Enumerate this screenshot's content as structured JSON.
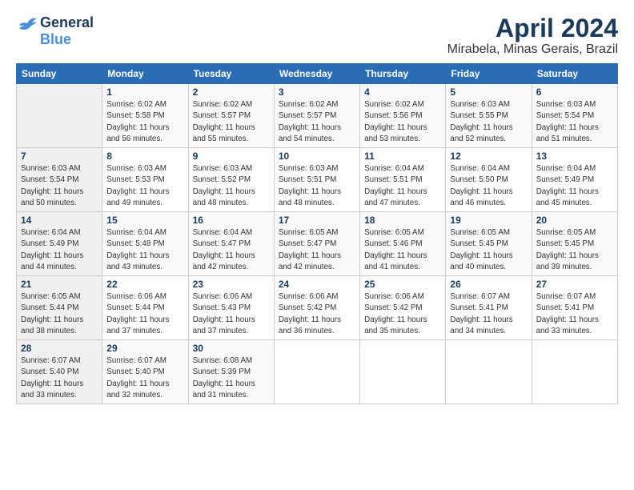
{
  "logo": {
    "line1": "General",
    "line2": "Blue"
  },
  "title": "April 2024",
  "subtitle": "Mirabela, Minas Gerais, Brazil",
  "days_of_week": [
    "Sunday",
    "Monday",
    "Tuesday",
    "Wednesday",
    "Thursday",
    "Friday",
    "Saturday"
  ],
  "weeks": [
    [
      {
        "day": "",
        "info": ""
      },
      {
        "day": "1",
        "info": "Sunrise: 6:02 AM\nSunset: 5:58 PM\nDaylight: 11 hours\nand 56 minutes."
      },
      {
        "day": "2",
        "info": "Sunrise: 6:02 AM\nSunset: 5:57 PM\nDaylight: 11 hours\nand 55 minutes."
      },
      {
        "day": "3",
        "info": "Sunrise: 6:02 AM\nSunset: 5:57 PM\nDaylight: 11 hours\nand 54 minutes."
      },
      {
        "day": "4",
        "info": "Sunrise: 6:02 AM\nSunset: 5:56 PM\nDaylight: 11 hours\nand 53 minutes."
      },
      {
        "day": "5",
        "info": "Sunrise: 6:03 AM\nSunset: 5:55 PM\nDaylight: 11 hours\nand 52 minutes."
      },
      {
        "day": "6",
        "info": "Sunrise: 6:03 AM\nSunset: 5:54 PM\nDaylight: 11 hours\nand 51 minutes."
      }
    ],
    [
      {
        "day": "7",
        "info": ""
      },
      {
        "day": "8",
        "info": "Sunrise: 6:03 AM\nSunset: 5:53 PM\nDaylight: 11 hours\nand 49 minutes."
      },
      {
        "day": "9",
        "info": "Sunrise: 6:03 AM\nSunset: 5:52 PM\nDaylight: 11 hours\nand 48 minutes."
      },
      {
        "day": "10",
        "info": "Sunrise: 6:03 AM\nSunset: 5:51 PM\nDaylight: 11 hours\nand 48 minutes."
      },
      {
        "day": "11",
        "info": "Sunrise: 6:04 AM\nSunset: 5:51 PM\nDaylight: 11 hours\nand 47 minutes."
      },
      {
        "day": "12",
        "info": "Sunrise: 6:04 AM\nSunset: 5:50 PM\nDaylight: 11 hours\nand 46 minutes."
      },
      {
        "day": "13",
        "info": "Sunrise: 6:04 AM\nSunset: 5:49 PM\nDaylight: 11 hours\nand 45 minutes."
      }
    ],
    [
      {
        "day": "14",
        "info": ""
      },
      {
        "day": "15",
        "info": "Sunrise: 6:04 AM\nSunset: 5:48 PM\nDaylight: 11 hours\nand 43 minutes."
      },
      {
        "day": "16",
        "info": "Sunrise: 6:04 AM\nSunset: 5:47 PM\nDaylight: 11 hours\nand 42 minutes."
      },
      {
        "day": "17",
        "info": "Sunrise: 6:05 AM\nSunset: 5:47 PM\nDaylight: 11 hours\nand 42 minutes."
      },
      {
        "day": "18",
        "info": "Sunrise: 6:05 AM\nSunset: 5:46 PM\nDaylight: 11 hours\nand 41 minutes."
      },
      {
        "day": "19",
        "info": "Sunrise: 6:05 AM\nSunset: 5:45 PM\nDaylight: 11 hours\nand 40 minutes."
      },
      {
        "day": "20",
        "info": "Sunrise: 6:05 AM\nSunset: 5:45 PM\nDaylight: 11 hours\nand 39 minutes."
      }
    ],
    [
      {
        "day": "21",
        "info": ""
      },
      {
        "day": "22",
        "info": "Sunrise: 6:06 AM\nSunset: 5:44 PM\nDaylight: 11 hours\nand 37 minutes."
      },
      {
        "day": "23",
        "info": "Sunrise: 6:06 AM\nSunset: 5:43 PM\nDaylight: 11 hours\nand 37 minutes."
      },
      {
        "day": "24",
        "info": "Sunrise: 6:06 AM\nSunset: 5:42 PM\nDaylight: 11 hours\nand 36 minutes."
      },
      {
        "day": "25",
        "info": "Sunrise: 6:06 AM\nSunset: 5:42 PM\nDaylight: 11 hours\nand 35 minutes."
      },
      {
        "day": "26",
        "info": "Sunrise: 6:07 AM\nSunset: 5:41 PM\nDaylight: 11 hours\nand 34 minutes."
      },
      {
        "day": "27",
        "info": "Sunrise: 6:07 AM\nSunset: 5:41 PM\nDaylight: 11 hours\nand 33 minutes."
      }
    ],
    [
      {
        "day": "28",
        "info": "Sunrise: 6:07 AM\nSunset: 5:40 PM\nDaylight: 11 hours\nand 33 minutes."
      },
      {
        "day": "29",
        "info": "Sunrise: 6:07 AM\nSunset: 5:40 PM\nDaylight: 11 hours\nand 32 minutes."
      },
      {
        "day": "30",
        "info": "Sunrise: 6:08 AM\nSunset: 5:39 PM\nDaylight: 11 hours\nand 31 minutes."
      },
      {
        "day": "",
        "info": ""
      },
      {
        "day": "",
        "info": ""
      },
      {
        "day": "",
        "info": ""
      },
      {
        "day": "",
        "info": ""
      }
    ]
  ],
  "week1_sunday_info": "Sunrise: 6:03 AM\nSunset: 5:54 PM\nDaylight: 11 hours\nand 50 minutes.",
  "week2_sunday_info": "Sunrise: 6:04 AM\nSunset: 5:49 PM\nDaylight: 11 hours\nand 44 minutes.",
  "week3_sunday_info": "Sunrise: 6:05 AM\nSunset: 5:44 PM\nDaylight: 11 hours\nand 38 minutes."
}
